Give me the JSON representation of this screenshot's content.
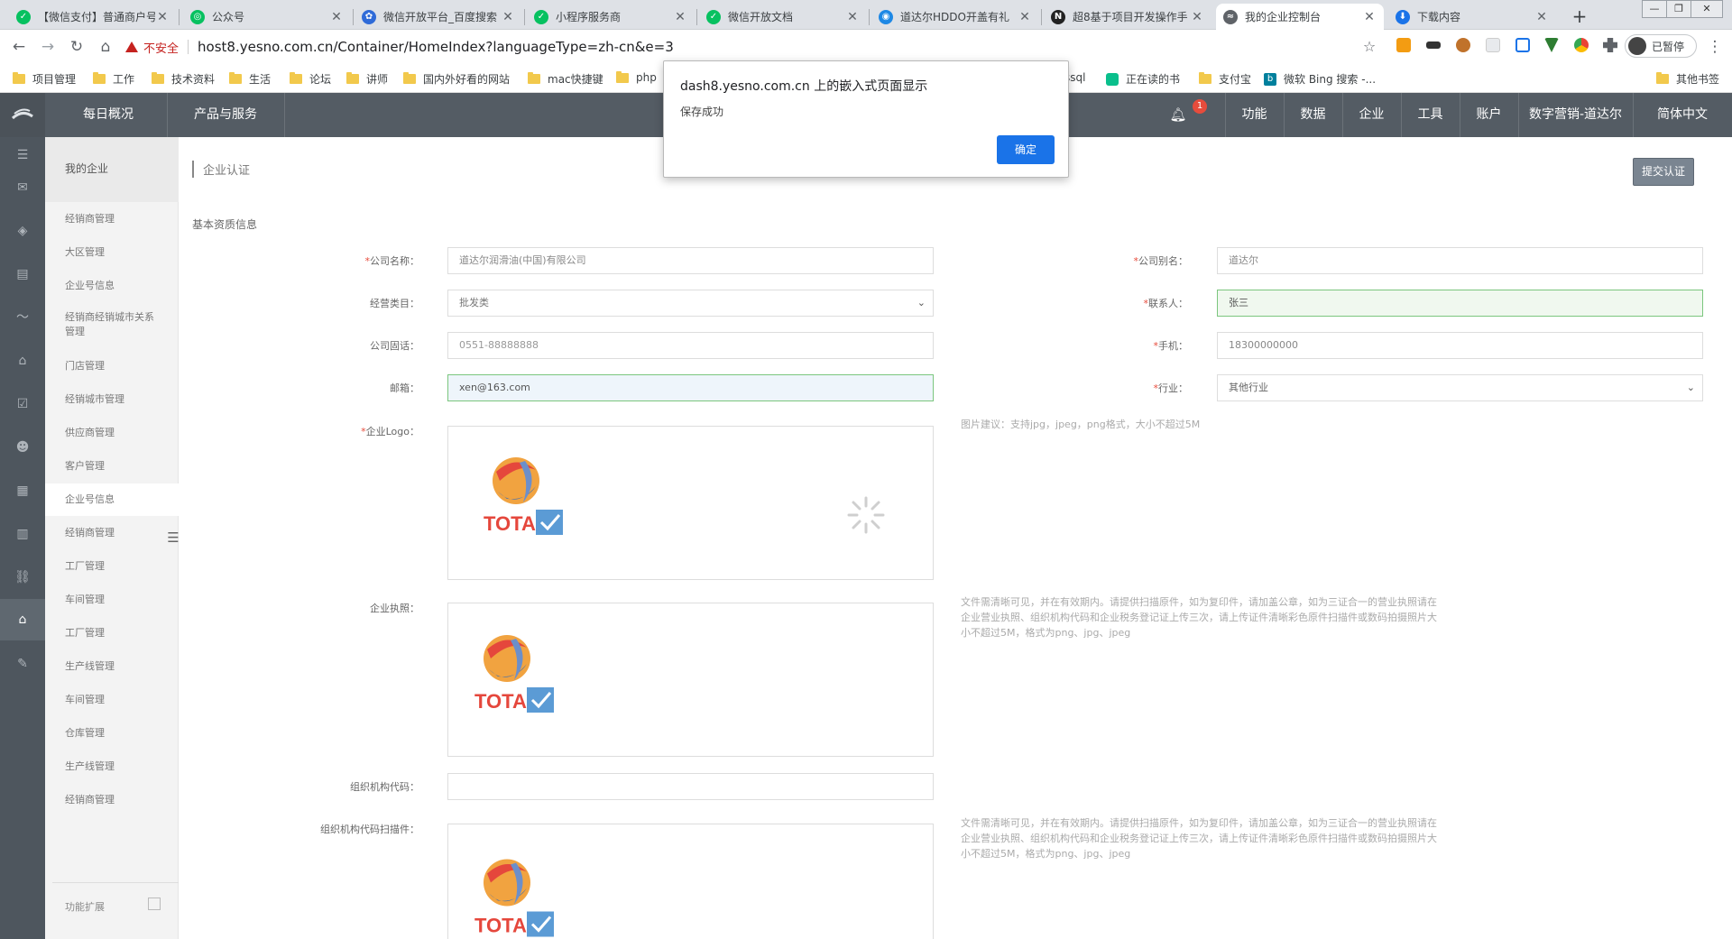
{
  "browser": {
    "tabs": [
      {
        "title": "【微信支付】普通商户号",
        "color": "#07c160",
        "glyph": "✓"
      },
      {
        "title": "公众号",
        "color": "#07c160",
        "glyph": "◎"
      },
      {
        "title": "微信开放平台_百度搜索",
        "color": "#2f6bd8",
        "glyph": "✿"
      },
      {
        "title": "小程序服务商",
        "color": "#07c160",
        "glyph": "✓"
      },
      {
        "title": "微信开放文档",
        "color": "#07c160",
        "glyph": "✓"
      },
      {
        "title": "道达尔HDDO开盖有礼",
        "color": "#1e88e5",
        "glyph": "◉"
      },
      {
        "title": "超8基于项目开发操作手",
        "color": "#222222",
        "glyph": "N"
      },
      {
        "title": "我的企业控制台",
        "color": "#5f6368",
        "glyph": "≈"
      },
      {
        "title": "下载内容",
        "color": "#1a73e8",
        "glyph": "⬇"
      }
    ],
    "insecure_label": "不安全",
    "url": "host8.yesno.com.cn/Container/HomeIndex?languageType=zh-cn&e=3",
    "profile_label": "已暂停",
    "bookmarks": [
      "项目管理",
      "工作",
      "技术资料",
      "生活",
      "论坛",
      "讲师",
      "国内外好看的网站",
      "mac快捷键",
      "php"
    ],
    "bookmarks_right": [
      "ssql",
      "正在读的书",
      "支付宝",
      "微软 Bing 搜索 -..."
    ],
    "bookmarks_other": "其他书签"
  },
  "dialog": {
    "title": "dash8.yesno.com.cn 上的嵌入式页面显示",
    "message": "保存成功",
    "ok_label": "确定"
  },
  "topnav": {
    "left": [
      "每日概况",
      "产品与服务"
    ],
    "badge": "1",
    "right": [
      "功能",
      "数据",
      "企业",
      "工具",
      "账户",
      "数字营销-道达尔",
      "简体中文"
    ]
  },
  "sidebar": {
    "header": "我的企业",
    "items": [
      "经销商管理",
      "大区管理",
      "企业号信息",
      "经销商经销城市关系管理",
      "门店管理",
      "经销城市管理",
      "供应商管理",
      "客户管理",
      "企业号信息",
      "经销商管理",
      "工厂管理",
      "车间管理",
      "工厂管理",
      "生产线管理",
      "车间管理",
      "仓库管理",
      "生产线管理",
      "经销商管理"
    ],
    "footer": "功能扩展"
  },
  "page": {
    "breadcrumb": "企业认证",
    "submit_label": "提交认证",
    "section_title": "基本资质信息"
  },
  "form": {
    "company_name": {
      "label": "公司名称：",
      "value": "道达尔润滑油(中国)有限公司"
    },
    "company_alias": {
      "label": "公司别名：",
      "value": "道达尔"
    },
    "business_category": {
      "label": "经营类目：",
      "value": "批发类"
    },
    "contact": {
      "label": "联系人：",
      "value": "张三"
    },
    "phone": {
      "label": "公司固话：",
      "value": "0551-88888888"
    },
    "mobile": {
      "label": "手机：",
      "value": "18300000000"
    },
    "email": {
      "label": "邮箱：",
      "value": "xen@163.com"
    },
    "industry": {
      "label": "行业：",
      "value": "其他行业"
    },
    "logo": {
      "label": "企业Logo：",
      "hint": "图片建议：支持jpg，jpeg，png格式，大小不超过5M"
    },
    "license": {
      "label": "企业执照：",
      "hint": "文件需清晰可见，并在有效期内。请提供扫描原件，如为复印件，请加盖公章，如为三证合一的营业执照请在企业营业执照、组织机构代码和企业税务登记证上传三次，请上传证件清晰彩色原件扫描件或数码拍摄照片大小不超过5M，格式为png、jpg、jpeg"
    },
    "org_code": {
      "label": "组织机构代码：",
      "value": ""
    },
    "org_scan": {
      "label": "组织机构代码扫描件：",
      "hint": "文件需清晰可见，并在有效期内。请提供扫描原件，如为复印件，请加盖公章，如为三证合一的营业执照请在企业营业执照、组织机构代码和企业税务登记证上传三次，请上传证件清晰彩色原件扫描件或数码拍摄照片大小不超过5M，格式为png、jpg、jpeg"
    },
    "logo_text": "TOTAL"
  },
  "colors": {
    "nav": "#545c64",
    "accent": "#1a73e8",
    "required": "#e74c3c"
  }
}
